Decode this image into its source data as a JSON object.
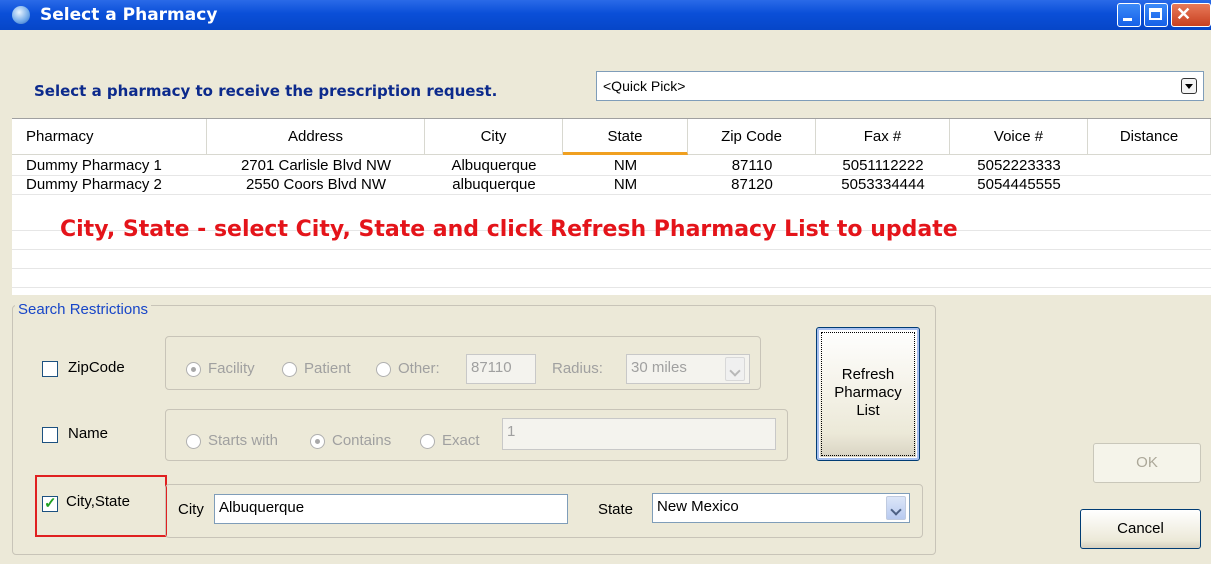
{
  "window": {
    "title": "Select a Pharmacy"
  },
  "prompt": "Select a pharmacy to receive the prescription request.",
  "quick_pick": {
    "value": "<Quick Pick>"
  },
  "grid": {
    "columns": [
      "Pharmacy",
      "Address",
      "City",
      "State",
      "Zip Code",
      "Fax #",
      "Voice #",
      "Distance"
    ],
    "sorted_column": "State",
    "rows": [
      [
        "Dummy Pharmacy 1",
        "2701 Carlisle Blvd NW",
        "Albuquerque",
        "NM",
        "87110",
        "5051112222",
        "5052223333",
        ""
      ],
      [
        "Dummy Pharmacy 2",
        "2550 Coors Blvd NW",
        "albuquerque",
        "NM",
        "87120",
        "5053334444",
        "5054445555",
        ""
      ]
    ]
  },
  "annotation": "City, State - select City, State and click Refresh Pharmacy List to update",
  "search": {
    "title": "Search Restrictions",
    "zipcode": {
      "label": "ZipCode",
      "checked": false,
      "facility": "Facility",
      "patient": "Patient",
      "other": "Other:",
      "selected": "Facility",
      "other_value": "87110",
      "radius_label": "Radius:",
      "radius_value": "30 miles"
    },
    "name": {
      "label": "Name",
      "checked": false,
      "starts_with": "Starts with",
      "contains": "Contains",
      "exact": "Exact",
      "selected": "Contains",
      "value": "1"
    },
    "citystate": {
      "label": "City,State",
      "checked": true,
      "city_label": "City",
      "city_value": "Albuquerque",
      "state_label": "State",
      "state_value": "New Mexico"
    }
  },
  "buttons": {
    "refresh": "Refresh Pharmacy List",
    "ok": "OK",
    "cancel": "Cancel"
  },
  "colors": {
    "annotation": "#e4141a",
    "prompt": "#0c2a8c",
    "titlebar": "#0a4fd8"
  }
}
